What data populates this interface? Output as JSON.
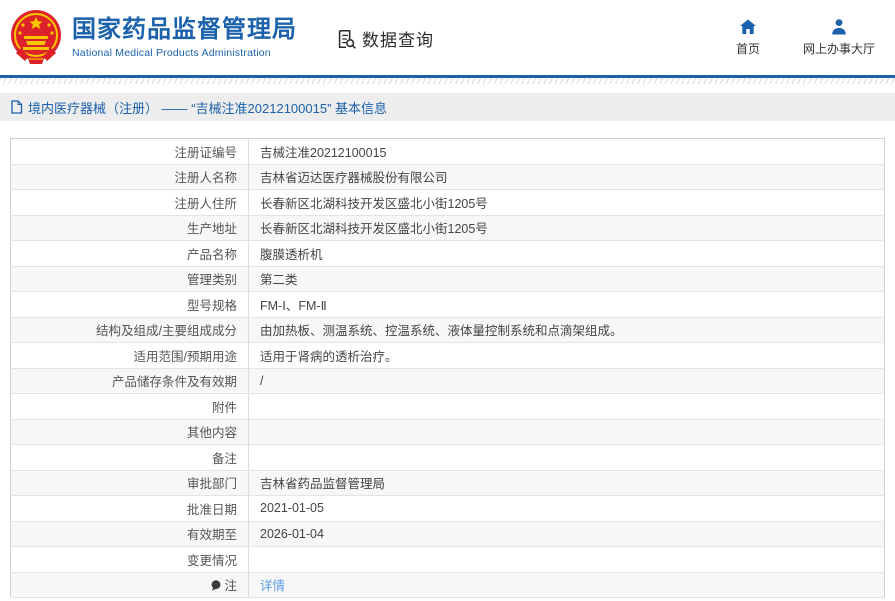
{
  "header": {
    "site_title": "国家药品监督管理局",
    "site_subtitle": "National Medical Products Administration",
    "section_label": "数据查询",
    "nav": {
      "home": "首页",
      "service_hall": "网上办事大厅"
    }
  },
  "breadcrumb": {
    "text": "境内医疗器械（注册） —— “吉械注准20212100015” 基本信息"
  },
  "table": {
    "rows": [
      {
        "label": "注册证编号",
        "value": "吉械注准20212100015"
      },
      {
        "label": "注册人名称",
        "value": "吉林省迈达医疗器械股份有限公司"
      },
      {
        "label": "注册人住所",
        "value": "长春新区北湖科技开发区盛北小街1205号"
      },
      {
        "label": "生产地址",
        "value": "长春新区北湖科技开发区盛北小街1205号"
      },
      {
        "label": "产品名称",
        "value": "腹膜透析机"
      },
      {
        "label": "管理类别",
        "value": "第二类"
      },
      {
        "label": "型号规格",
        "value": "FM-Ⅰ、FM-Ⅱ"
      },
      {
        "label": "结构及组成/主要组成成分",
        "value": "由加热板、测温系统、控温系统、液体量控制系统和点滴架组成。"
      },
      {
        "label": "适用范围/预期用途",
        "value": "适用于肾病的透析治疗。"
      },
      {
        "label": "产品储存条件及有效期",
        "value": "/"
      },
      {
        "label": "附件",
        "value": ""
      },
      {
        "label": "其他内容",
        "value": ""
      },
      {
        "label": "备注",
        "value": ""
      },
      {
        "label": "审批部门",
        "value": "吉林省药品监督管理局"
      },
      {
        "label": "批准日期",
        "value": "2021-01-05"
      },
      {
        "label": "有效期至",
        "value": "2026-01-04"
      },
      {
        "label": "变更情况",
        "value": ""
      },
      {
        "label": "注",
        "value": "详情",
        "link": true,
        "note_icon": true
      }
    ]
  },
  "colors": {
    "brand_blue": "#1b61ac",
    "link_blue": "#5b9de8",
    "crumb_bg": "#ededed",
    "row_alt_bg": "#f7f7f7",
    "emblem_red": "#de2128",
    "emblem_gold": "#f7c700"
  }
}
